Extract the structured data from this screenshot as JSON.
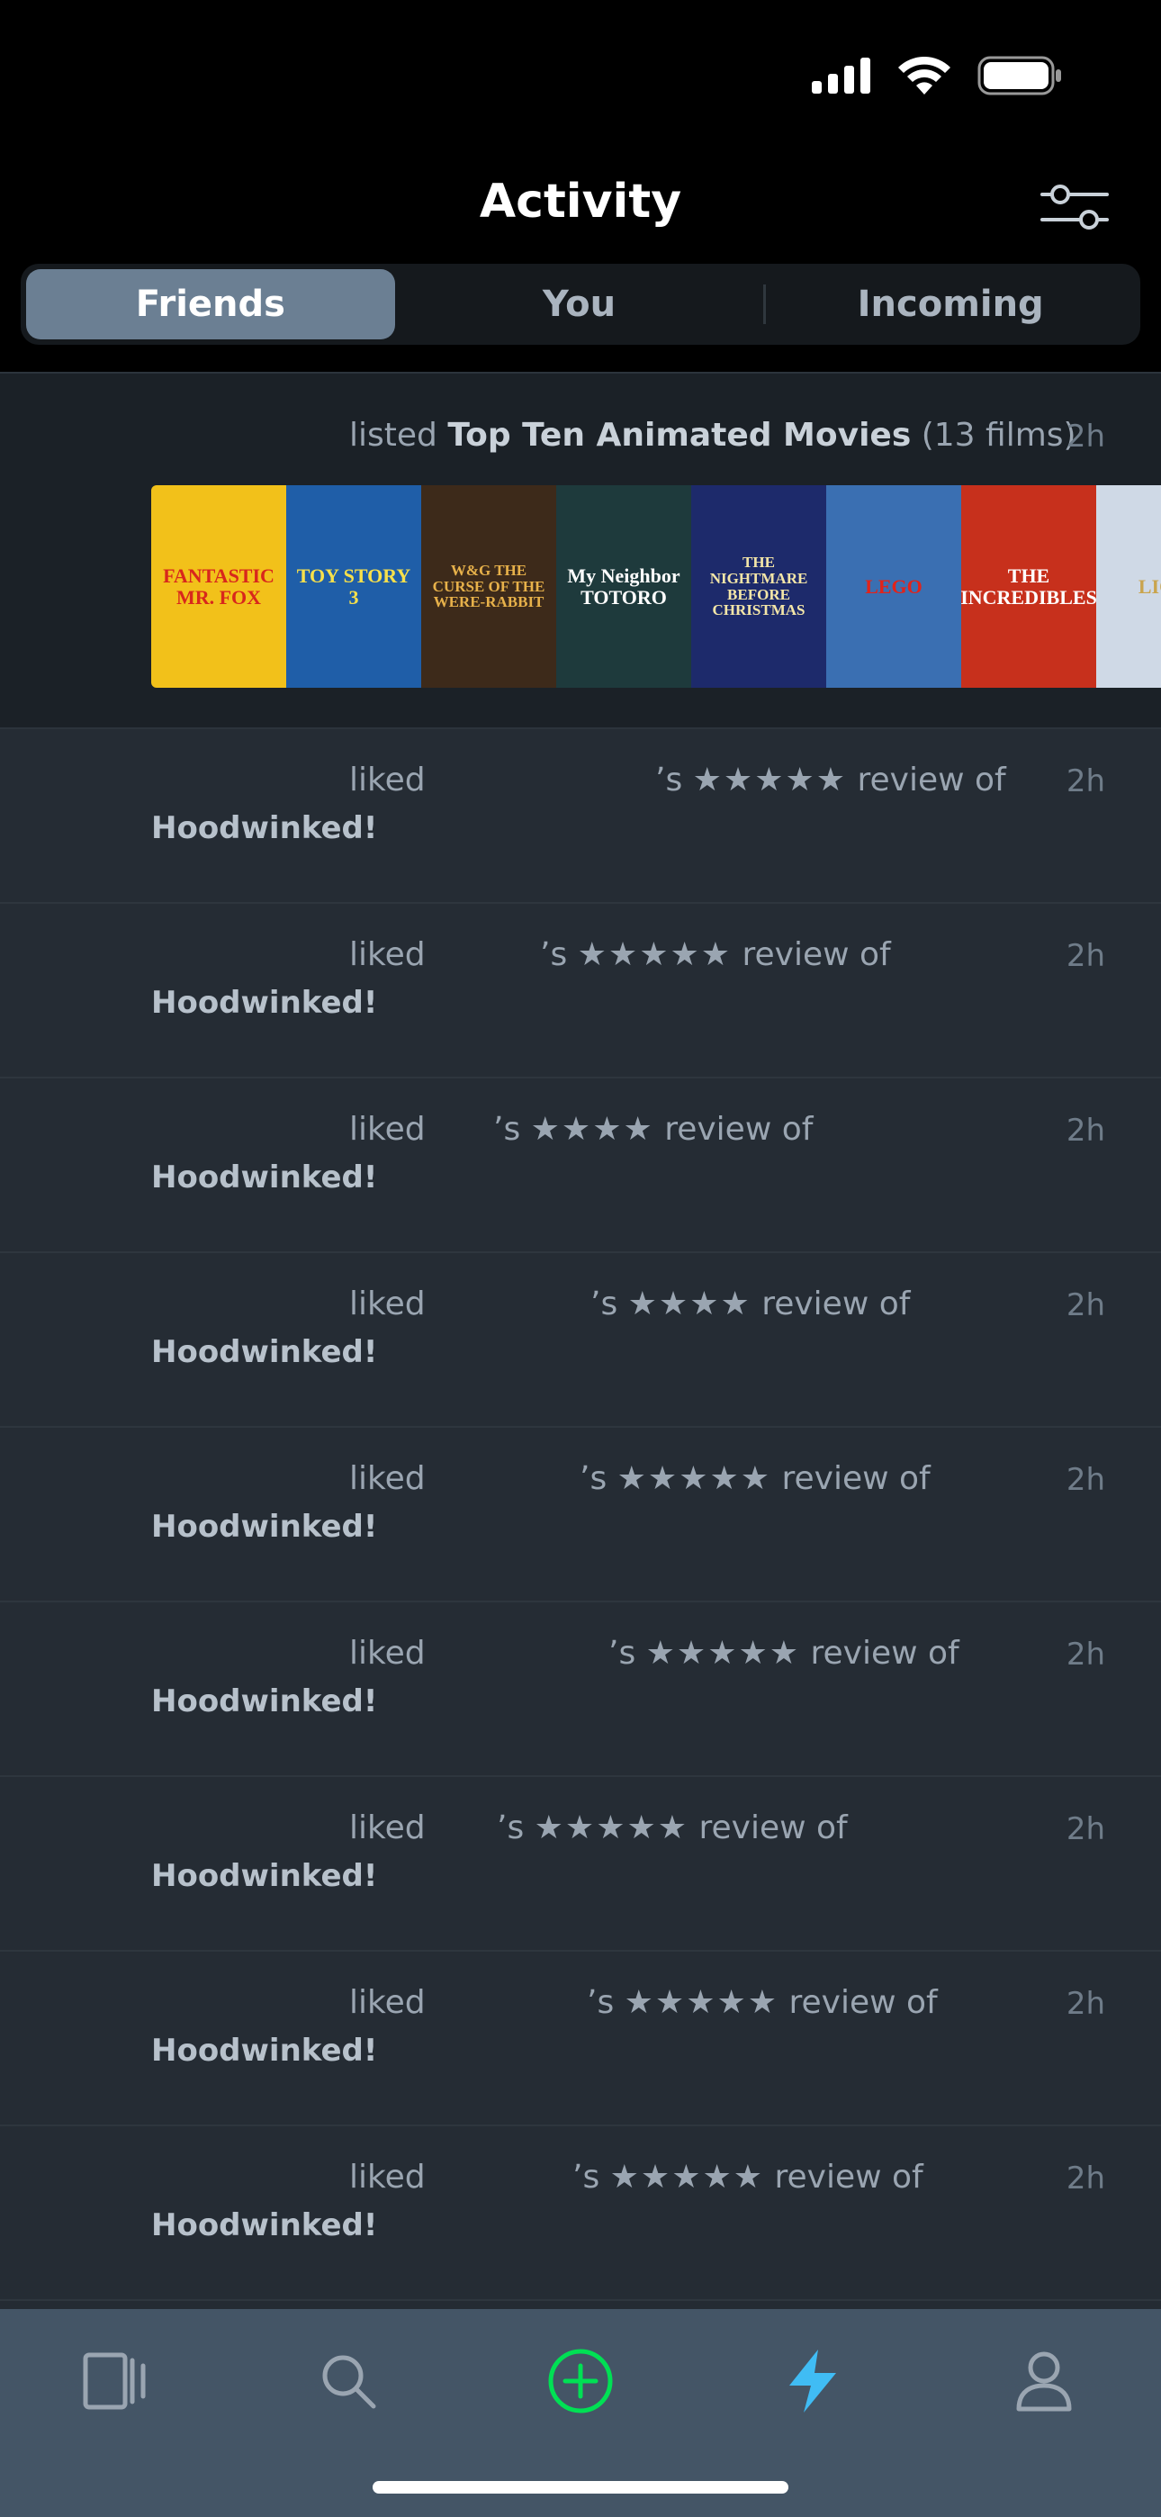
{
  "header": {
    "title": "Activity"
  },
  "tabs": [
    {
      "label": "Friends",
      "active": true
    },
    {
      "label": "You",
      "active": false
    },
    {
      "label": "Incoming",
      "active": false
    }
  ],
  "list_activity": {
    "prefix": "listed",
    "list_name": "Top Ten Animated Movies",
    "count": "(13 films)",
    "time": "2h",
    "posters": [
      {
        "title": "FANTASTIC MR. FOX",
        "bg": "#f2c11a",
        "fg": "#d8271c"
      },
      {
        "title": "TOY STORY 3",
        "bg": "#1f5ea8",
        "fg": "#f7e04b"
      },
      {
        "title": "W&G THE CURSE OF THE WERE-RABBIT",
        "bg": "#3d2a1a",
        "fg": "#e7b14a"
      },
      {
        "title": "My Neighbor TOTORO",
        "bg": "#1e3a3c",
        "fg": "#ffffff"
      },
      {
        "title": "THE NIGHTMARE BEFORE CHRISTMAS",
        "bg": "#1d2a6b",
        "fg": "#f4e6a8"
      },
      {
        "title": "LEGO",
        "bg": "#3a6fb2",
        "fg": "#e2231a"
      },
      {
        "title": "THE INCREDIBLES",
        "bg": "#c7301c",
        "fg": "#ffffff"
      },
      {
        "title": "LION",
        "bg": "#cfd9e6",
        "fg": "#c9a44d"
      }
    ]
  },
  "activities": [
    {
      "prefix": "liked",
      "suffix": "’s",
      "stars": "★★★★★",
      "review": "review of",
      "film": "Hoodwinked!",
      "time": "2h",
      "offset": 728
    },
    {
      "prefix": "liked",
      "suffix": "’s",
      "stars": "★★★★★",
      "review": "review of",
      "film": "Hoodwinked!",
      "time": "2h",
      "offset": 600
    },
    {
      "prefix": "liked",
      "suffix": "’s",
      "stars": "★★★★",
      "review": "review of",
      "film": "Hoodwinked!",
      "time": "2h",
      "offset": 548
    },
    {
      "prefix": "liked",
      "suffix": "’s",
      "stars": "★★★★",
      "review": "review of",
      "film": "Hoodwinked!",
      "time": "2h",
      "offset": 656
    },
    {
      "prefix": "liked",
      "suffix": "’s",
      "stars": "★★★★★",
      "review": "review of",
      "film": "Hoodwinked!",
      "time": "2h",
      "offset": 644
    },
    {
      "prefix": "liked",
      "suffix": "’s",
      "stars": "★★★★★",
      "review": "review of",
      "film": "Hoodwinked!",
      "time": "2h",
      "offset": 676
    },
    {
      "prefix": "liked",
      "suffix": "’s",
      "stars": "★★★★★",
      "review": "review of",
      "film": "Hoodwinked!",
      "time": "2h",
      "offset": 552
    },
    {
      "prefix": "liked",
      "suffix": "’s",
      "stars": "★★★★★",
      "review": "review of",
      "film": "Hoodwinked!",
      "time": "2h",
      "offset": 652
    },
    {
      "prefix": "liked",
      "suffix": "’s",
      "stars": "★★★★★",
      "review": "review of",
      "film": "Hoodwinked!",
      "time": "2h",
      "offset": 636
    }
  ],
  "tab_bar": {
    "items": [
      "films-icon",
      "search-icon",
      "add-icon",
      "activity-icon",
      "profile-icon"
    ],
    "active": "activity-icon",
    "accent": "#40bcf4",
    "add_color": "#00e054"
  }
}
